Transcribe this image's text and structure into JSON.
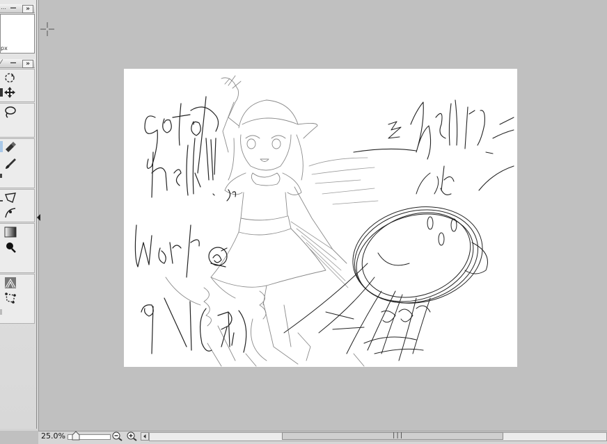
{
  "navigator": {
    "unit_label": "px",
    "minimize_label": "—",
    "expand_label": "»",
    "title_fragment": "…"
  },
  "toolbox": {
    "minimize_label": "—",
    "expand_label": "»"
  },
  "status": {
    "zoom": "25.0%",
    "scroll_grip": "|||"
  },
  "colors": {
    "workspace": "#c0c0c0",
    "canvas": "#ffffff",
    "stroke": "#111111"
  },
  "canvas_text": {
    "goto": "goto",
    "hell_left": "hell!!",
    "small_note": "うる",
    "hell_right": "hell!",
    "date": "9/1 (月)",
    "sign": "wer"
  }
}
